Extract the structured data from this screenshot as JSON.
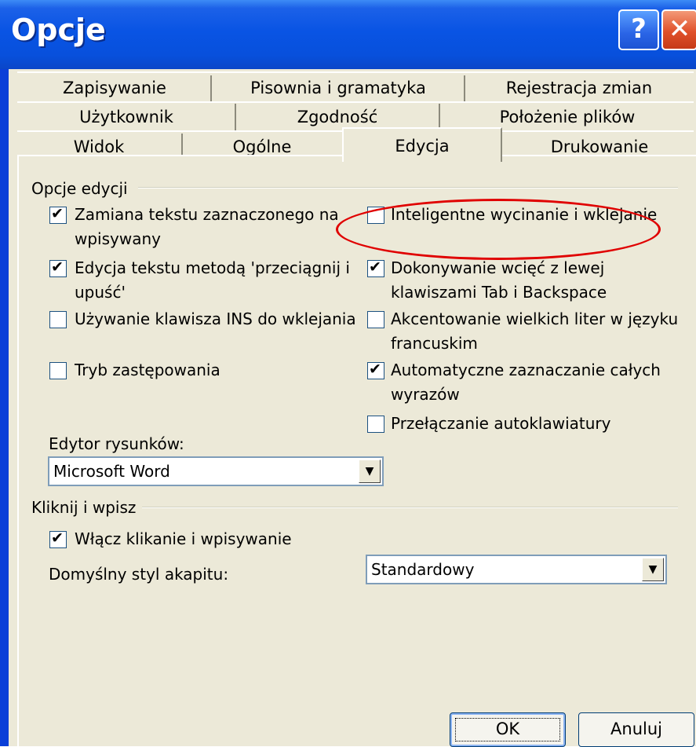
{
  "window": {
    "title": "Opcje",
    "help_label": "?",
    "close_label": "✕"
  },
  "tabs": {
    "row1": [
      "Zapisywanie",
      "Pisownia i gramatyka",
      "Rejestracja zmian"
    ],
    "row2": [
      "Użytkownik",
      "Zgodność",
      "Położenie plików"
    ],
    "row3": [
      "Widok",
      "Ogólne",
      "Edycja",
      "Drukowanie"
    ],
    "active": "Edycja"
  },
  "group_edit": {
    "title": "Opcje edycji",
    "options": [
      {
        "label": "Zamiana tekstu zaznaczonego na",
        "label2": "wpisywany",
        "checked": true
      },
      {
        "label": "Edycja tekstu metodą 'przeciągnij i",
        "label2": "upuść'",
        "checked": true
      },
      {
        "label": "Używanie klawisza INS do wklejania",
        "checked": false
      },
      {
        "label": "Tryb zastępowania",
        "checked": false
      },
      {
        "label": "Inteligentne wycinanie i wklejanie",
        "checked": false
      },
      {
        "label": "Dokonywanie wcięć z lewej",
        "label2": "klawiszami Tab i Backspace",
        "checked": true
      },
      {
        "label": "Akcentowanie wielkich liter w języku",
        "label2": "francuskim",
        "checked": false
      },
      {
        "label": "Automatyczne zaznaczanie całych",
        "label2": "wyrazów",
        "checked": true
      },
      {
        "label": "Przełączanie autoklawiatury",
        "checked": false
      }
    ]
  },
  "picture_editor": {
    "label": "Edytor rysunków:",
    "value": "Microsoft Word"
  },
  "group_click": {
    "title": "Kliknij i wpisz",
    "enable": {
      "label": "Włącz klikanie i wpisywanie",
      "checked": true
    },
    "style_label": "Domyślny styl akapitu:",
    "style_value": "Standardowy"
  },
  "buttons": {
    "ok": "OK",
    "cancel": "Anuluj"
  },
  "colors": {
    "title_bar": "#0954e4",
    "dialog_bg": "#ece9d8",
    "annotation": "#e00000"
  }
}
